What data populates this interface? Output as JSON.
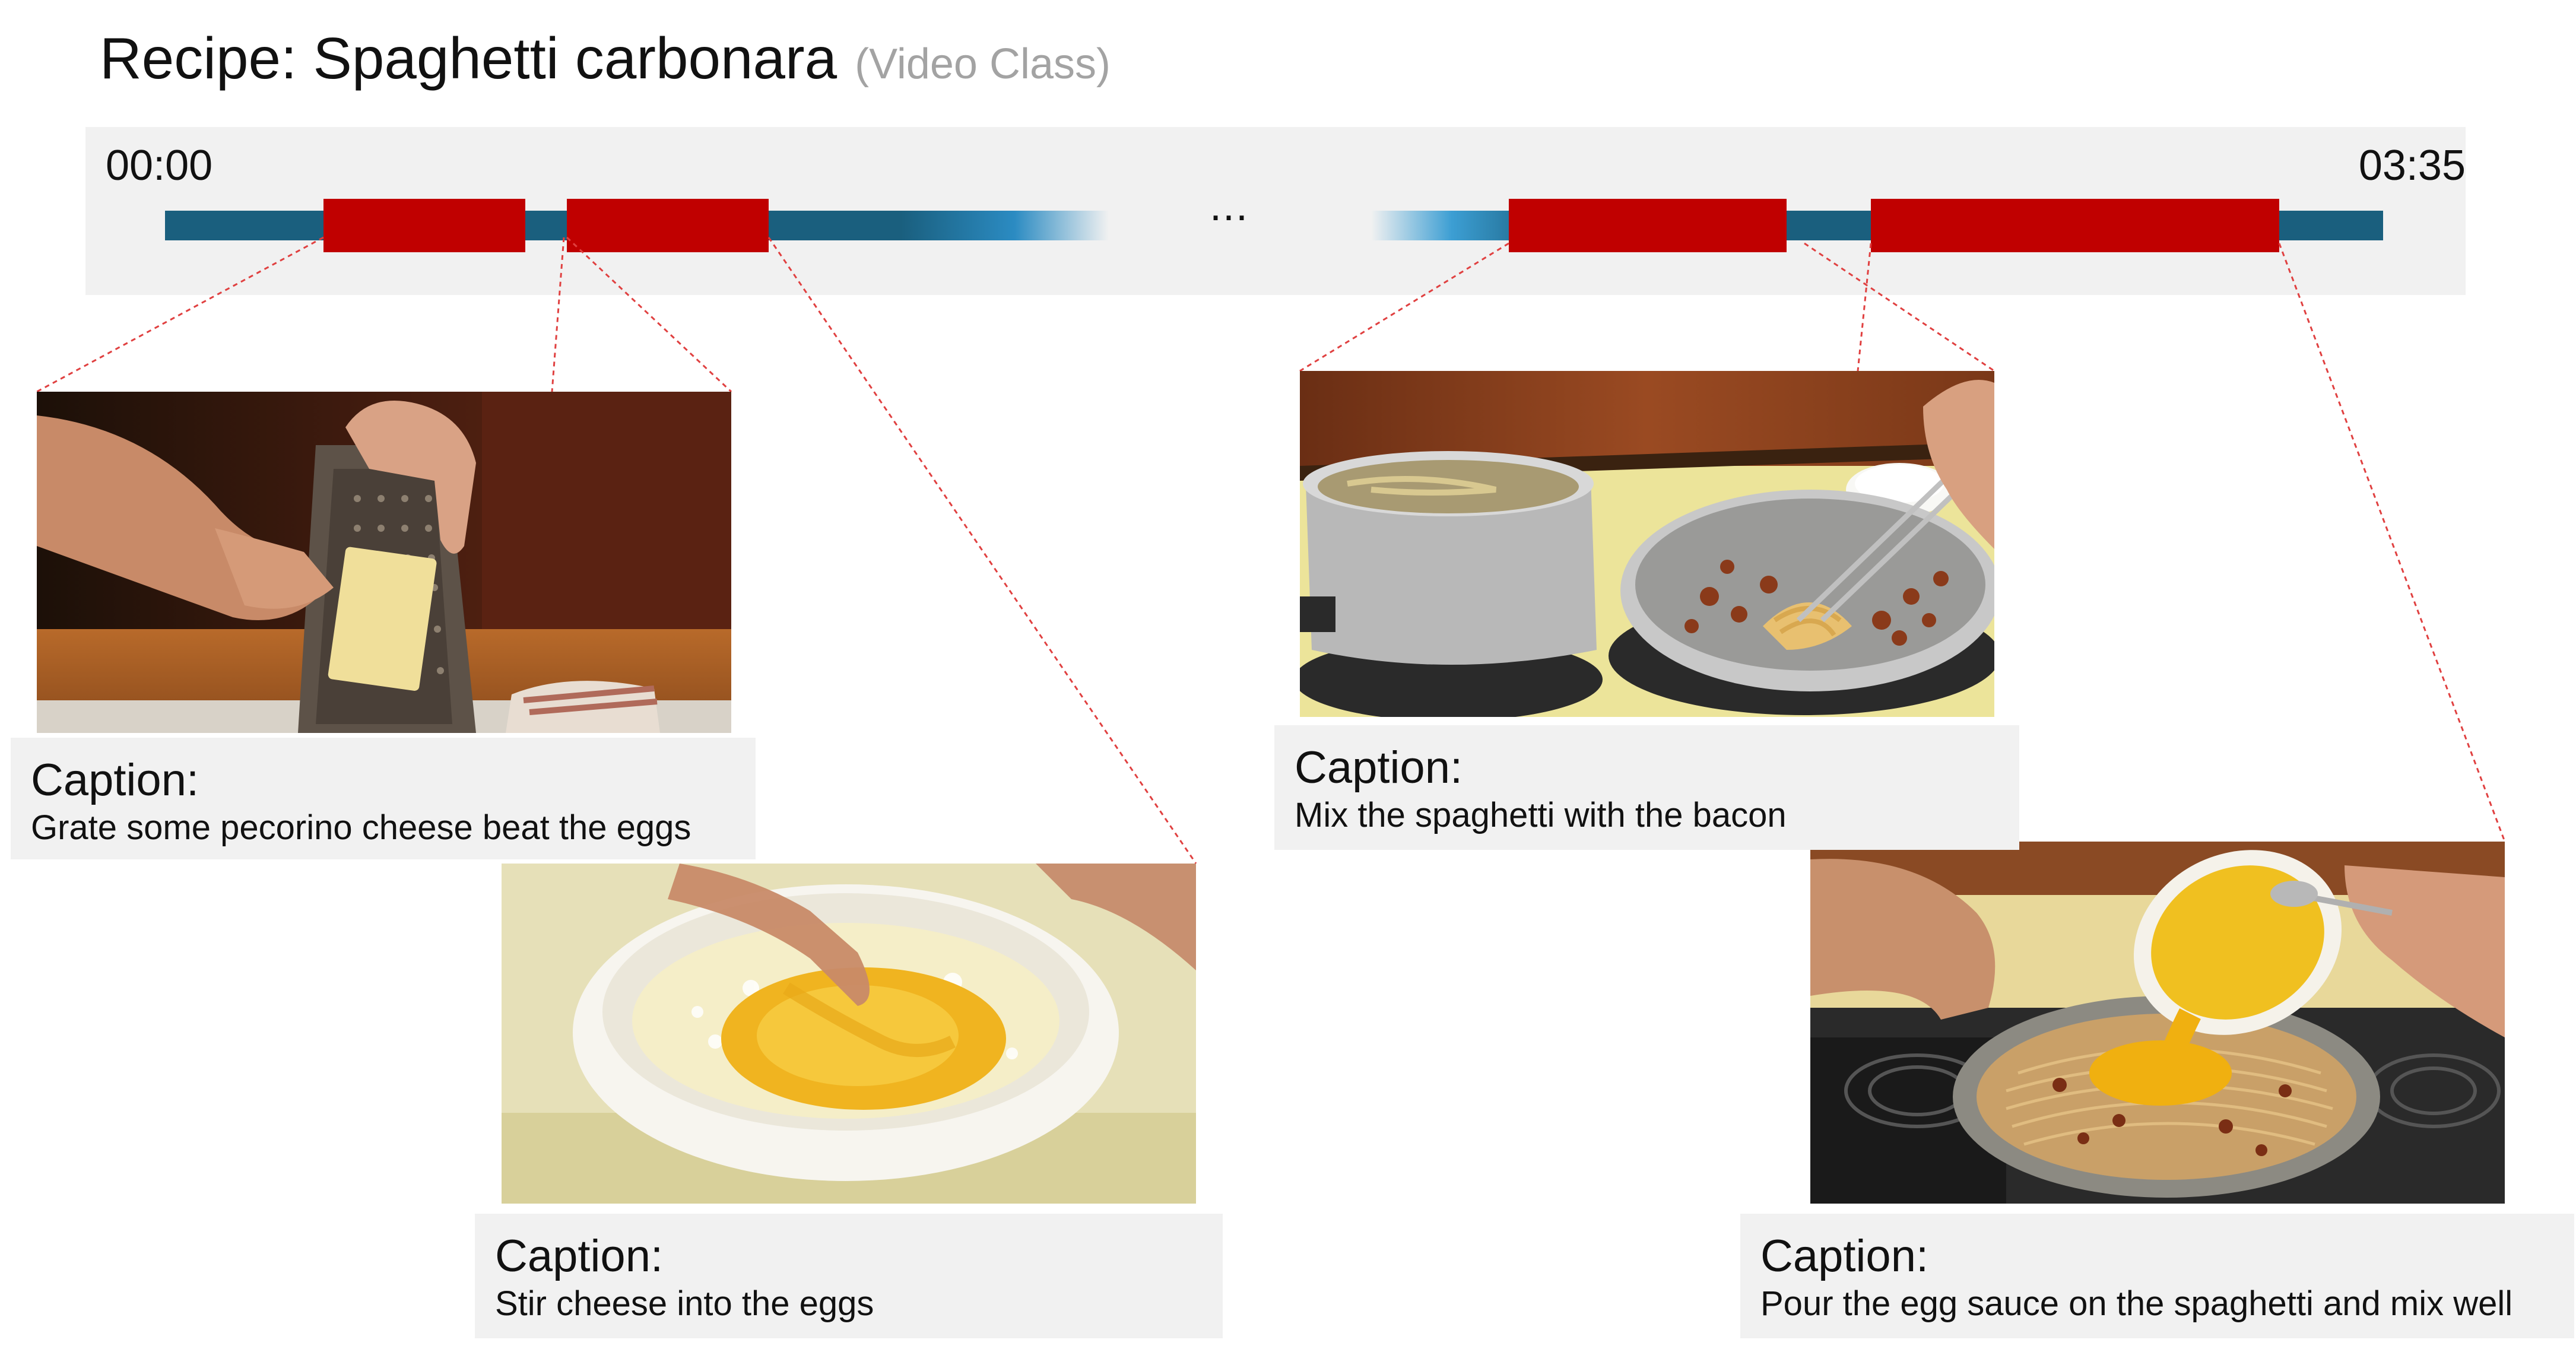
{
  "title": "Recipe: Spaghetti carbonara",
  "subtitle": "(Video Class)",
  "timeline": {
    "start_time": "00:00",
    "end_time": "03:35",
    "gap_marker": "...",
    "track_color": "#1a5f7e",
    "segment_color": "#c00000"
  },
  "steps": [
    {
      "caption_heading": "Caption:",
      "caption_text": "Grate some pecorino cheese beat the eggs"
    },
    {
      "caption_heading": "Caption:",
      "caption_text": "Stir cheese into the eggs"
    },
    {
      "caption_heading": "Caption:",
      "caption_text": "Mix the spaghetti with the bacon"
    },
    {
      "caption_heading": "Caption:",
      "caption_text": "Pour the egg sauce on the spaghetti and mix well"
    }
  ]
}
